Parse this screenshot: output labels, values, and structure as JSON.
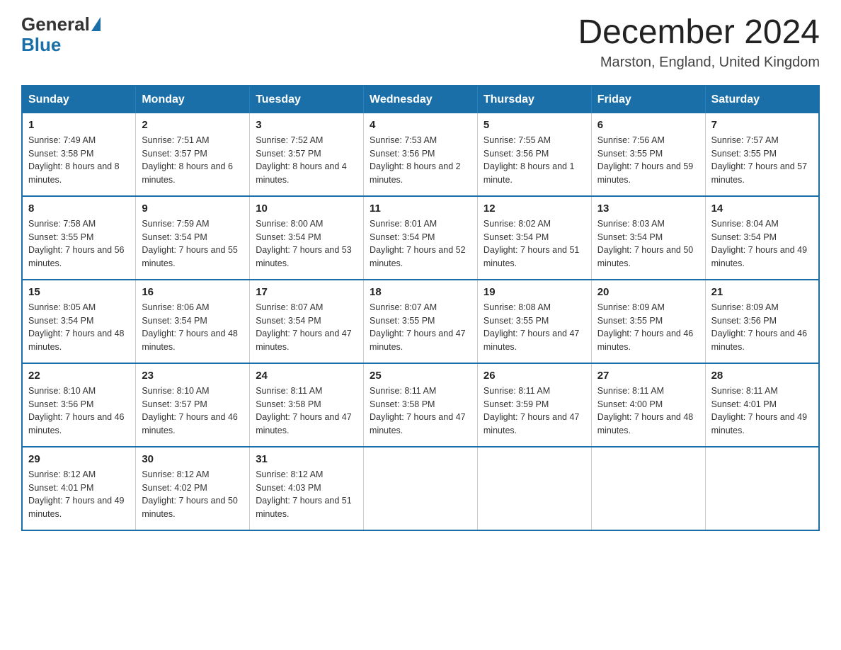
{
  "header": {
    "logo_line1": "General",
    "logo_line2": "Blue",
    "title": "December 2024",
    "location": "Marston, England, United Kingdom"
  },
  "days_of_week": [
    "Sunday",
    "Monday",
    "Tuesday",
    "Wednesday",
    "Thursday",
    "Friday",
    "Saturday"
  ],
  "weeks": [
    [
      {
        "day": "1",
        "sunrise": "7:49 AM",
        "sunset": "3:58 PM",
        "daylight": "8 hours and 8 minutes."
      },
      {
        "day": "2",
        "sunrise": "7:51 AM",
        "sunset": "3:57 PM",
        "daylight": "8 hours and 6 minutes."
      },
      {
        "day": "3",
        "sunrise": "7:52 AM",
        "sunset": "3:57 PM",
        "daylight": "8 hours and 4 minutes."
      },
      {
        "day": "4",
        "sunrise": "7:53 AM",
        "sunset": "3:56 PM",
        "daylight": "8 hours and 2 minutes."
      },
      {
        "day": "5",
        "sunrise": "7:55 AM",
        "sunset": "3:56 PM",
        "daylight": "8 hours and 1 minute."
      },
      {
        "day": "6",
        "sunrise": "7:56 AM",
        "sunset": "3:55 PM",
        "daylight": "7 hours and 59 minutes."
      },
      {
        "day": "7",
        "sunrise": "7:57 AM",
        "sunset": "3:55 PM",
        "daylight": "7 hours and 57 minutes."
      }
    ],
    [
      {
        "day": "8",
        "sunrise": "7:58 AM",
        "sunset": "3:55 PM",
        "daylight": "7 hours and 56 minutes."
      },
      {
        "day": "9",
        "sunrise": "7:59 AM",
        "sunset": "3:54 PM",
        "daylight": "7 hours and 55 minutes."
      },
      {
        "day": "10",
        "sunrise": "8:00 AM",
        "sunset": "3:54 PM",
        "daylight": "7 hours and 53 minutes."
      },
      {
        "day": "11",
        "sunrise": "8:01 AM",
        "sunset": "3:54 PM",
        "daylight": "7 hours and 52 minutes."
      },
      {
        "day": "12",
        "sunrise": "8:02 AM",
        "sunset": "3:54 PM",
        "daylight": "7 hours and 51 minutes."
      },
      {
        "day": "13",
        "sunrise": "8:03 AM",
        "sunset": "3:54 PM",
        "daylight": "7 hours and 50 minutes."
      },
      {
        "day": "14",
        "sunrise": "8:04 AM",
        "sunset": "3:54 PM",
        "daylight": "7 hours and 49 minutes."
      }
    ],
    [
      {
        "day": "15",
        "sunrise": "8:05 AM",
        "sunset": "3:54 PM",
        "daylight": "7 hours and 48 minutes."
      },
      {
        "day": "16",
        "sunrise": "8:06 AM",
        "sunset": "3:54 PM",
        "daylight": "7 hours and 48 minutes."
      },
      {
        "day": "17",
        "sunrise": "8:07 AM",
        "sunset": "3:54 PM",
        "daylight": "7 hours and 47 minutes."
      },
      {
        "day": "18",
        "sunrise": "8:07 AM",
        "sunset": "3:55 PM",
        "daylight": "7 hours and 47 minutes."
      },
      {
        "day": "19",
        "sunrise": "8:08 AM",
        "sunset": "3:55 PM",
        "daylight": "7 hours and 47 minutes."
      },
      {
        "day": "20",
        "sunrise": "8:09 AM",
        "sunset": "3:55 PM",
        "daylight": "7 hours and 46 minutes."
      },
      {
        "day": "21",
        "sunrise": "8:09 AM",
        "sunset": "3:56 PM",
        "daylight": "7 hours and 46 minutes."
      }
    ],
    [
      {
        "day": "22",
        "sunrise": "8:10 AM",
        "sunset": "3:56 PM",
        "daylight": "7 hours and 46 minutes."
      },
      {
        "day": "23",
        "sunrise": "8:10 AM",
        "sunset": "3:57 PM",
        "daylight": "7 hours and 46 minutes."
      },
      {
        "day": "24",
        "sunrise": "8:11 AM",
        "sunset": "3:58 PM",
        "daylight": "7 hours and 47 minutes."
      },
      {
        "day": "25",
        "sunrise": "8:11 AM",
        "sunset": "3:58 PM",
        "daylight": "7 hours and 47 minutes."
      },
      {
        "day": "26",
        "sunrise": "8:11 AM",
        "sunset": "3:59 PM",
        "daylight": "7 hours and 47 minutes."
      },
      {
        "day": "27",
        "sunrise": "8:11 AM",
        "sunset": "4:00 PM",
        "daylight": "7 hours and 48 minutes."
      },
      {
        "day": "28",
        "sunrise": "8:11 AM",
        "sunset": "4:01 PM",
        "daylight": "7 hours and 49 minutes."
      }
    ],
    [
      {
        "day": "29",
        "sunrise": "8:12 AM",
        "sunset": "4:01 PM",
        "daylight": "7 hours and 49 minutes."
      },
      {
        "day": "30",
        "sunrise": "8:12 AM",
        "sunset": "4:02 PM",
        "daylight": "7 hours and 50 minutes."
      },
      {
        "day": "31",
        "sunrise": "8:12 AM",
        "sunset": "4:03 PM",
        "daylight": "7 hours and 51 minutes."
      },
      null,
      null,
      null,
      null
    ]
  ]
}
